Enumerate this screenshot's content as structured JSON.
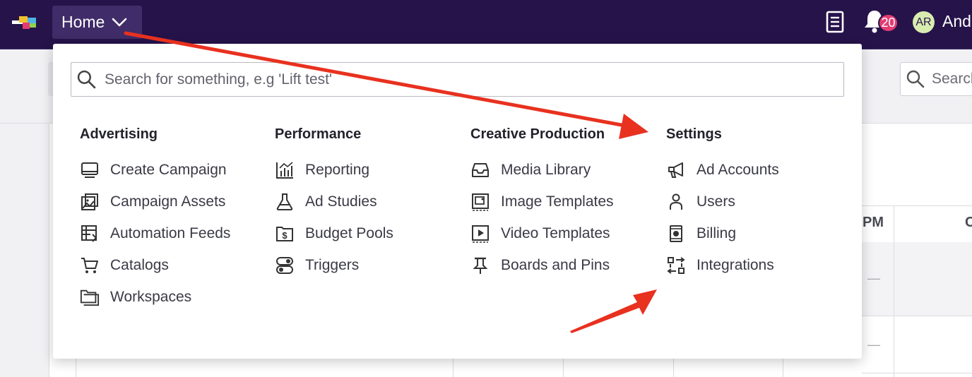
{
  "topbar": {
    "home_label": "Home",
    "notification_count": "20",
    "avatar_initials": "AR",
    "user_name": "And",
    "icons": [
      "brand-logo",
      "chevron-down-icon",
      "document-icon",
      "bell-icon"
    ]
  },
  "background": {
    "search_placeholder": "Search",
    "table_header_1": "PM",
    "table_header_2": "C",
    "dash": "—"
  },
  "menu": {
    "search_placeholder": "Search for something, e.g 'Lift test'",
    "columns": [
      {
        "title": "Advertising",
        "items": [
          {
            "label": "Create Campaign",
            "icon": "monitor-icon"
          },
          {
            "label": "Campaign Assets",
            "icon": "images-icon"
          },
          {
            "label": "Automation Feeds",
            "icon": "automation-table-icon"
          },
          {
            "label": "Catalogs",
            "icon": "cart-icon"
          },
          {
            "label": "Workspaces",
            "icon": "folders-icon"
          }
        ]
      },
      {
        "title": "Performance",
        "items": [
          {
            "label": "Reporting",
            "icon": "chart-icon"
          },
          {
            "label": "Ad Studies",
            "icon": "flask-icon"
          },
          {
            "label": "Budget Pools",
            "icon": "dollar-folder-icon"
          },
          {
            "label": "Triggers",
            "icon": "toggle-icon"
          }
        ]
      },
      {
        "title": "Creative Production",
        "items": [
          {
            "label": "Media Library",
            "icon": "inbox-icon"
          },
          {
            "label": "Image Templates",
            "icon": "image-template-icon"
          },
          {
            "label": "Video Templates",
            "icon": "video-template-icon"
          },
          {
            "label": "Boards and Pins",
            "icon": "pin-icon"
          }
        ]
      },
      {
        "title": "Settings",
        "items": [
          {
            "label": "Ad Accounts",
            "icon": "megaphone-icon"
          },
          {
            "label": "Users",
            "icon": "user-icon"
          },
          {
            "label": "Billing",
            "icon": "billing-icon"
          },
          {
            "label": "Integrations",
            "icon": "integrations-icon"
          }
        ]
      }
    ]
  },
  "colors": {
    "topbar": "#26134a",
    "home_button": "#3f2c68",
    "badge": "#e23c73",
    "avatar": "#d9ecb0",
    "annotation_arrow": "#e8311f"
  }
}
